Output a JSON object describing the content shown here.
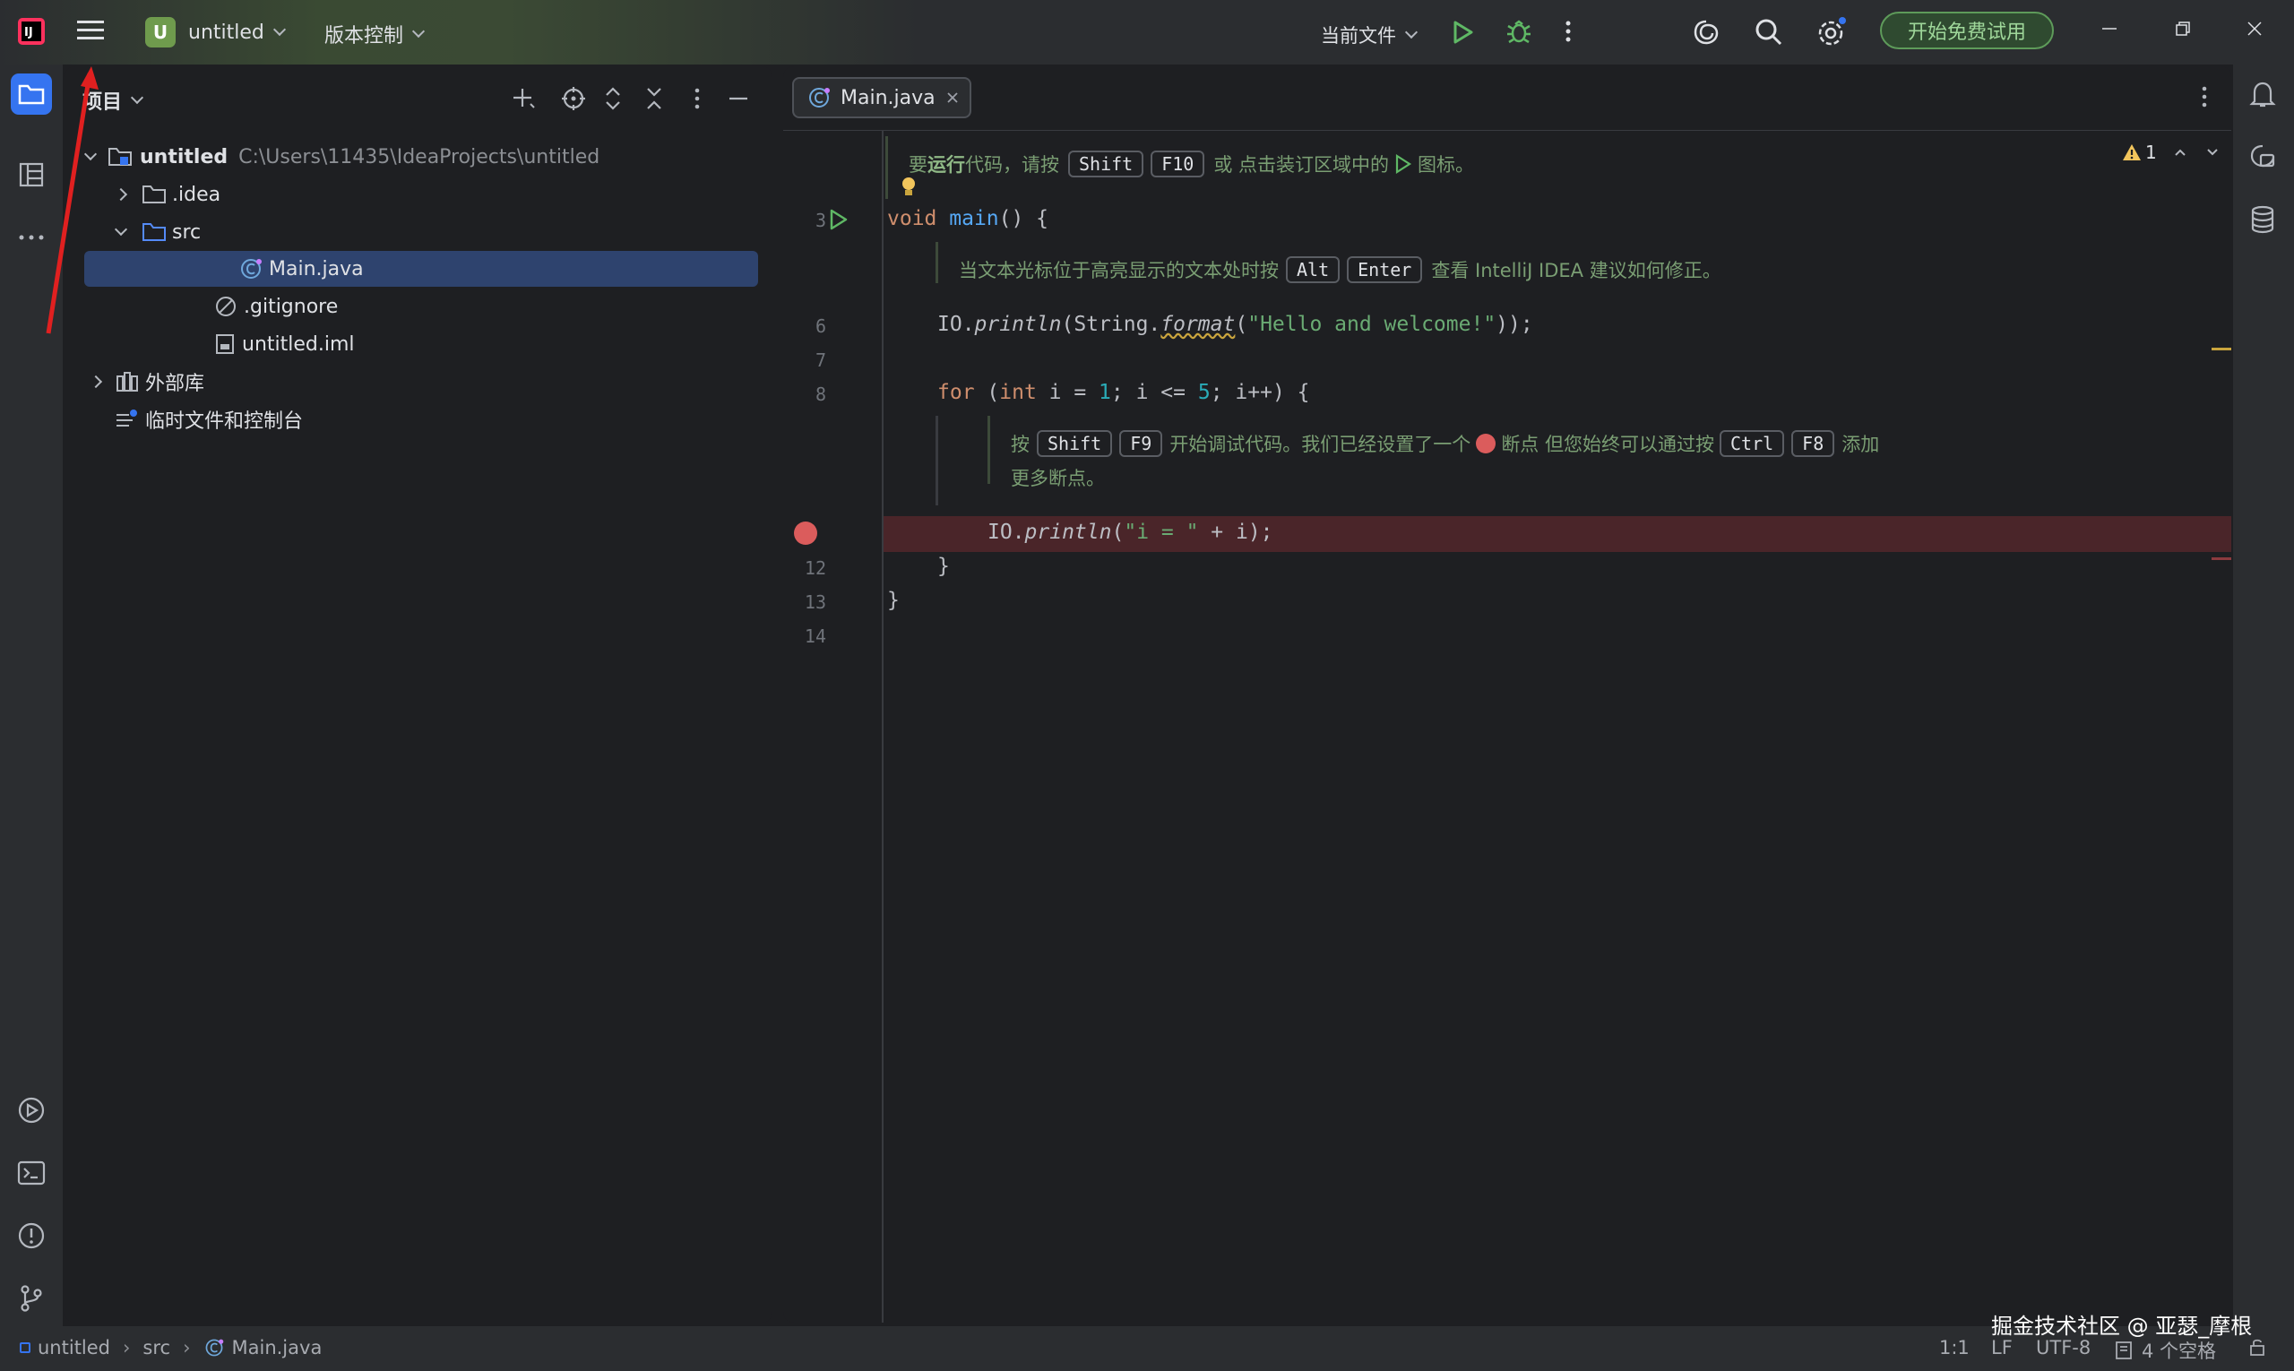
{
  "titlebar": {
    "project_badge": "U",
    "project_name": "untitled",
    "vcs_label": "版本控制",
    "run_config": "当前文件",
    "trial_button": "开始免费试用"
  },
  "project_panel": {
    "title": "项目",
    "tree": [
      {
        "label": "untitled",
        "path": "C:\\Users\\11435\\IdeaProjects\\untitled"
      },
      {
        "label": ".idea"
      },
      {
        "label": "src"
      },
      {
        "label": "Main.java"
      },
      {
        "label": ".gitignore"
      },
      {
        "label": "untitled.iml"
      },
      {
        "label": "外部库"
      },
      {
        "label": "临时文件和控制台"
      }
    ]
  },
  "editor": {
    "tab_label": "Main.java",
    "warnings_count": "1",
    "hint1": {
      "pre": "要",
      "bold": "运行",
      "mid": "代码，请按",
      "k1": "Shift",
      "k2": "F10",
      "post": "或 点击装订区域中的",
      "end": "图标。"
    },
    "hint2": {
      "pre": "当文本光标位于高亮显示的文本处时按",
      "k1": "Alt",
      "k2": "Enter",
      "post": "查看 IntelliJ IDEA 建议如何修正。"
    },
    "hint3": {
      "pre": "按",
      "k1": "Shift",
      "k2": "F9",
      "mid": "开始调试代码。我们已经设置了一个",
      "mid2": "断点 但您始终可以通过按",
      "k3": "Ctrl",
      "k4": "F8",
      "post": "添加",
      "line2": "更多断点。"
    },
    "line_numbers": [
      "3",
      "6",
      "7",
      "8",
      "12",
      "13",
      "14"
    ],
    "code": {
      "l3_kw": "void",
      "l3_fn": "main",
      "l3_rest": "() {",
      "l6_a": "IO.",
      "l6_b": "println",
      "l6_c": "(String.",
      "l6_d": "format",
      "l6_e": "(",
      "l6_str": "\"Hello and welcome!\"",
      "l6_f": "));",
      "l8_kw": "for",
      "l8_a": " (",
      "l8_kw2": "int",
      "l8_b": " i = ",
      "l8_n1": "1",
      "l8_c": "; i <= ",
      "l8_n2": "5",
      "l8_d": "; i++) {",
      "l11_a": "IO.",
      "l11_b": "println",
      "l11_c": "(",
      "l11_str": "\"i = \"",
      "l11_d": " + i);",
      "l12": "}",
      "l13": "}"
    }
  },
  "statusbar": {
    "crumbs": [
      "untitled",
      "src",
      "Main.java"
    ],
    "position": "1:1",
    "line_sep": "LF",
    "encoding": "UTF-8",
    "indent": "4 个空格"
  },
  "watermark": "掘金技术社区 @ 亚瑟_摩根"
}
